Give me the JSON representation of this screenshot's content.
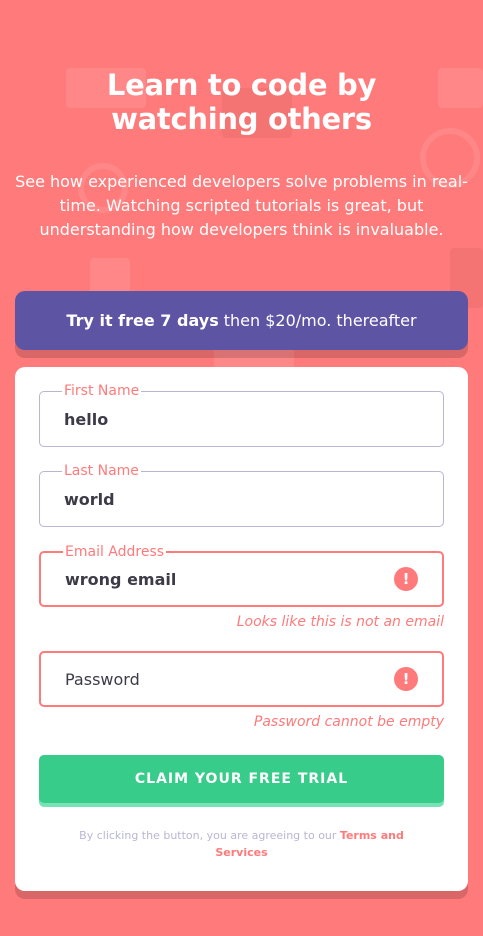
{
  "headline": "Learn to code by watching others",
  "intro": "See how experienced developers solve problems in real-time. Watching scripted tutorials is great, but understanding how developers think is invaluable.",
  "promo": {
    "bold": "Try it free 7 days",
    "rest": "then $20/mo. thereafter"
  },
  "form": {
    "first_name": {
      "label": "First Name",
      "value": "hello"
    },
    "last_name": {
      "label": "Last Name",
      "value": "world"
    },
    "email": {
      "label": "Email Address",
      "value": "wrong email",
      "error": "Looks like this is not an email"
    },
    "password": {
      "placeholder": "Password",
      "error": "Password cannot be empty"
    },
    "submit_label": "CLAIM YOUR FREE TRIAL",
    "terms_prefix": "By clicking the button, you are agreeing to our",
    "terms_link": "Terms and Services"
  },
  "colors": {
    "background": "#ff7a7a",
    "promo": "#5e54a4",
    "cta": "#38cc8b",
    "error": "#ff7a7a"
  }
}
